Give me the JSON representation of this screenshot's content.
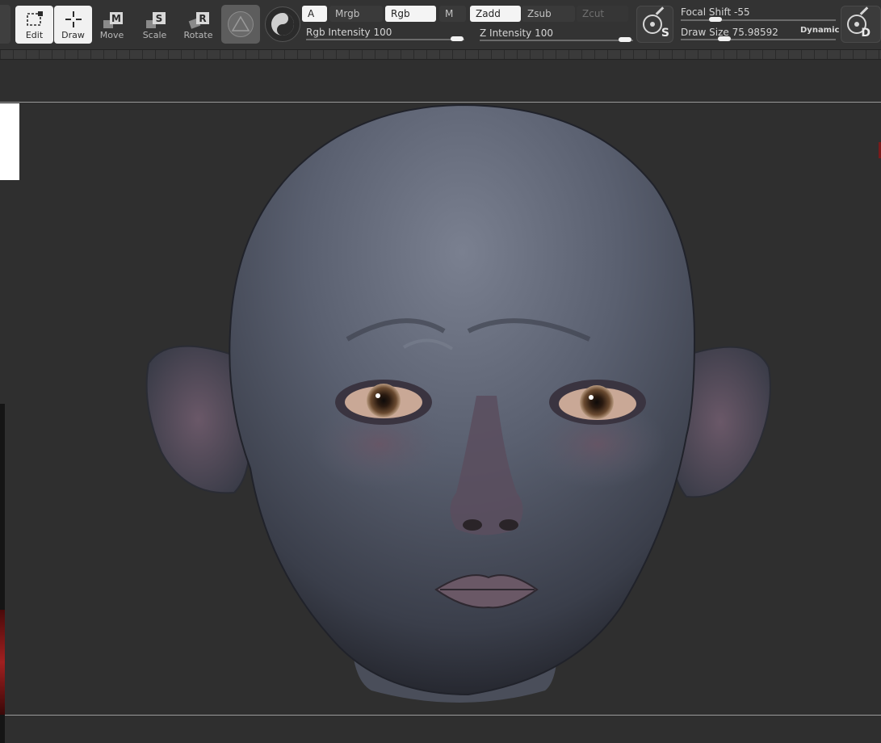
{
  "tools": {
    "edit": "Edit",
    "draw": "Draw",
    "move": "Move",
    "scale": "Scale",
    "rotate": "Rotate",
    "move_key": "M",
    "scale_key": "S",
    "rotate_key": "R"
  },
  "modes": {
    "a": "A",
    "mrgb": "Mrgb",
    "rgb": "Rgb",
    "m": "M",
    "zadd": "Zadd",
    "zsub": "Zsub",
    "zcut": "Zcut"
  },
  "sliders": {
    "rgb_intensity_label": "Rgb Intensity",
    "rgb_intensity_value": "100",
    "z_intensity_label": "Z Intensity",
    "z_intensity_value": "100",
    "focal_shift_label": "Focal Shift",
    "focal_shift_value": "-55",
    "draw_size_label": "Draw Size",
    "draw_size_value": "75.98592",
    "dynamic_label": "Dynamic"
  },
  "brush_buttons": {
    "s_letter": "S",
    "d_letter": "D"
  },
  "colors": {
    "toolbar": "#333333",
    "canvas": "#2f2f2f",
    "active_button": "#f1f1f1",
    "skin": "#5a6070"
  }
}
